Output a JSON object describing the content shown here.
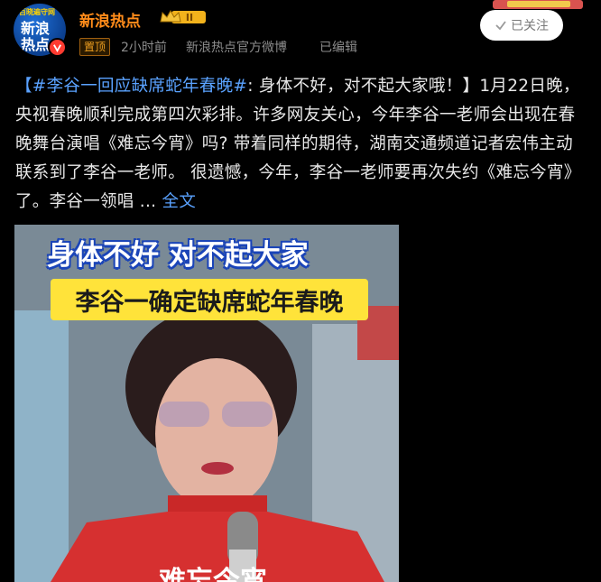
{
  "header": {
    "avatar_small_text": "百晓遍守网",
    "avatar_line1": "新浪",
    "avatar_line2": "热点",
    "account_name": "新浪热点",
    "crown_level": "II",
    "pin_label": "置顶",
    "time": "2小时前",
    "source": "新浪热点官方微博",
    "edited": "已编辑",
    "follow_label": "已关注"
  },
  "post": {
    "hashtag": "【#李谷一回应缺席蛇年春晚#",
    "text": ": 身体不好，对不起大家哦！】1月22日晚，央视春晚顺利完成第四次彩排。许多网友关心，今年李谷一老师会出现在春晚舞台演唱《难忘今宵》吗? 带着同样的期待，湖南交通频道记者宏伟主动联系到了李谷一老师。 很遗憾，今年，李谷一老师要再次失约《难忘今宵》了。李谷一领唱 ... ",
    "more_label": "全文"
  },
  "video": {
    "caption_top": "身体不好 对不起大家",
    "caption_bottom": "李谷一确定缺席蛇年春晚",
    "subtitle_partial": "难忘今宵"
  }
}
